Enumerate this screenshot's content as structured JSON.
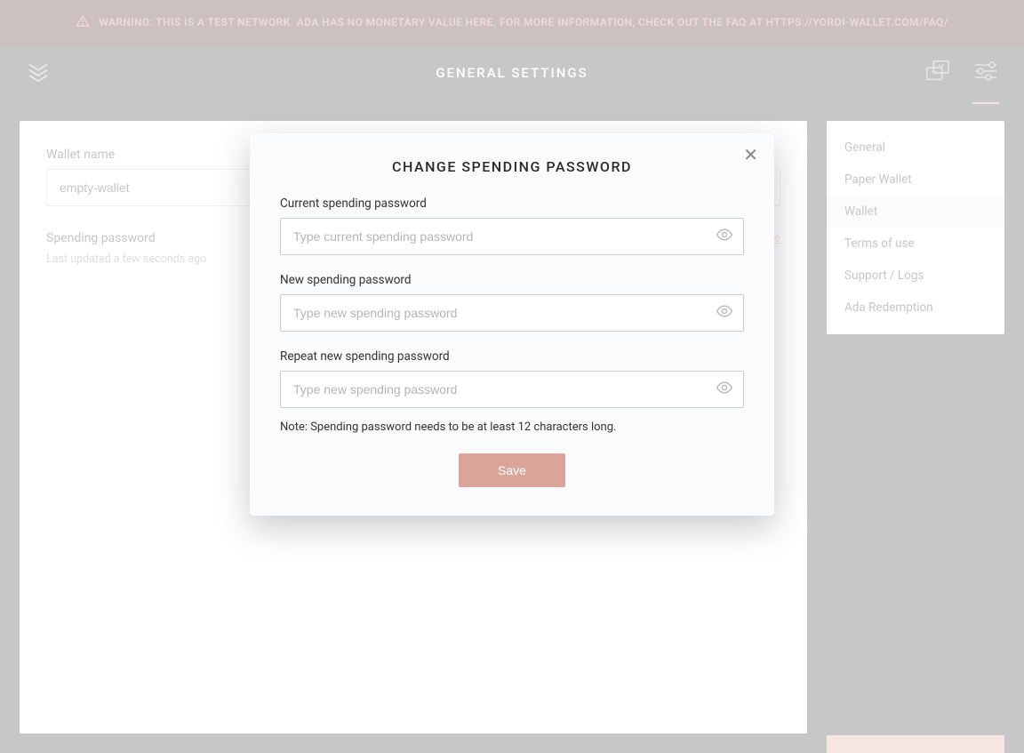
{
  "banner": {
    "text": "WARNING: THIS IS A TEST NETWORK. ADA HAS NO MONETARY VALUE HERE. FOR MORE INFORMATION, CHECK OUT THE FAQ AT HTTPS://YOROI-WALLET.COM/FAQ/"
  },
  "header": {
    "title": "GENERAL SETTINGS"
  },
  "main": {
    "wallet_name_label": "Wallet name",
    "wallet_name_value": "empty-wallet",
    "spending_label": "Spending password",
    "spending_sub": "Last updated a few seconds ago",
    "change_link": "change"
  },
  "sidebar": {
    "items": [
      {
        "label": "General"
      },
      {
        "label": "Paper Wallet"
      },
      {
        "label": "Wallet"
      },
      {
        "label": "Terms of use"
      },
      {
        "label": "Support / Logs"
      },
      {
        "label": "Ada Redemption"
      }
    ],
    "active_index": 2
  },
  "modal": {
    "title": "CHANGE SPENDING PASSWORD",
    "current_label": "Current spending password",
    "current_ph": "Type current spending password",
    "new_label": "New spending password",
    "new_ph": "Type new spending password",
    "repeat_label": "Repeat new spending password",
    "repeat_ph": "Type new spending password",
    "note": "Note: Spending password needs to be at least 12 characters long.",
    "save_label": "Save"
  }
}
